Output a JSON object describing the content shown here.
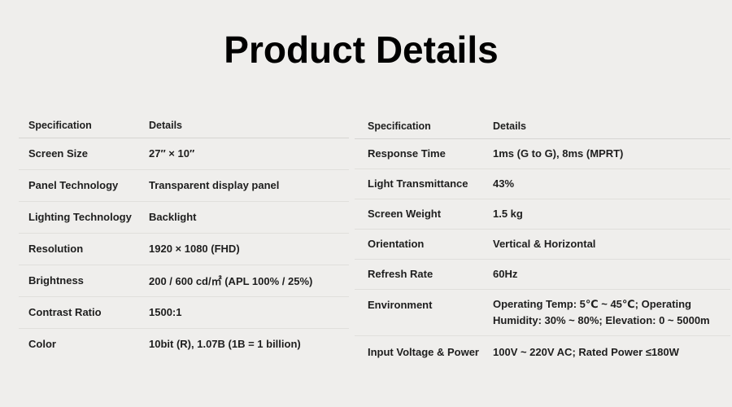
{
  "title": "Product Details",
  "left_table": {
    "headers": [
      "Specification",
      "Details"
    ],
    "rows": [
      [
        "Screen Size",
        "27″ × 10″"
      ],
      [
        "Panel Technology",
        "Transparent display panel"
      ],
      [
        "Lighting Technology",
        "Backlight"
      ],
      [
        "Resolution",
        "1920 × 1080 (FHD)"
      ],
      [
        "Brightness",
        "200 / 600 cd/㎡ (APL 100% / 25%)"
      ],
      [
        "Contrast Ratio",
        "1500:1"
      ],
      [
        "Color",
        "10bit (R), 1.07B (1B = 1 billion)"
      ]
    ]
  },
  "right_table": {
    "headers": [
      "Specification",
      "Details"
    ],
    "rows": [
      [
        "Response Time",
        "1ms (G to G), 8ms (MPRT)"
      ],
      [
        "Light Transmittance",
        "43%"
      ],
      [
        "Screen Weight",
        "1.5 kg"
      ],
      [
        "Orientation",
        "Vertical & Horizontal"
      ],
      [
        "Refresh Rate",
        "60Hz"
      ],
      [
        "Environment",
        "Operating Temp: 5℃ ~ 45℃; Operating Humidity: 30% ~ 80%; Elevation: 0 ~ 5000m"
      ],
      [
        "Input Voltage & Power",
        "100V ~ 220V AC; Rated Power ≤180W"
      ]
    ]
  }
}
